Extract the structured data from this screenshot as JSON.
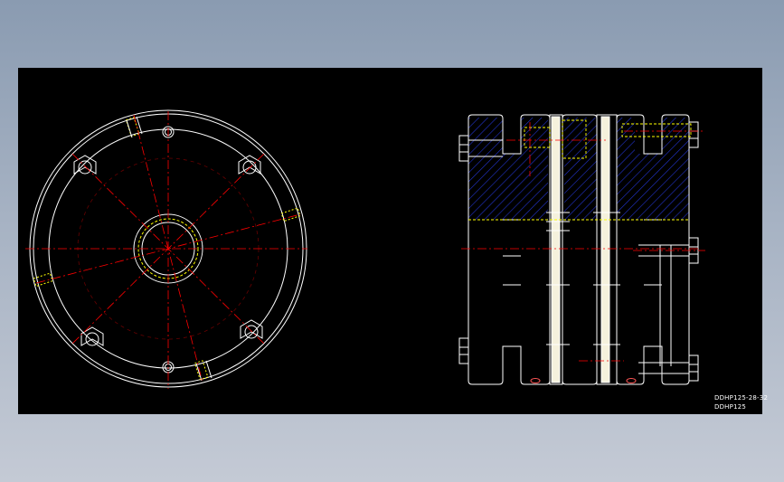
{
  "drawing": {
    "title_block": {
      "line1": "DDHP125-28-32",
      "line2": "DDHP125"
    },
    "colors": {
      "background": "#000000",
      "outline": "#ffffff",
      "centerline": "#ff0000",
      "hidden": "#ffff00",
      "hatch": "#1e2ab4",
      "viewport_frame": "#8ea0b6"
    },
    "views": [
      "front-view-flange",
      "side-view-section"
    ]
  }
}
